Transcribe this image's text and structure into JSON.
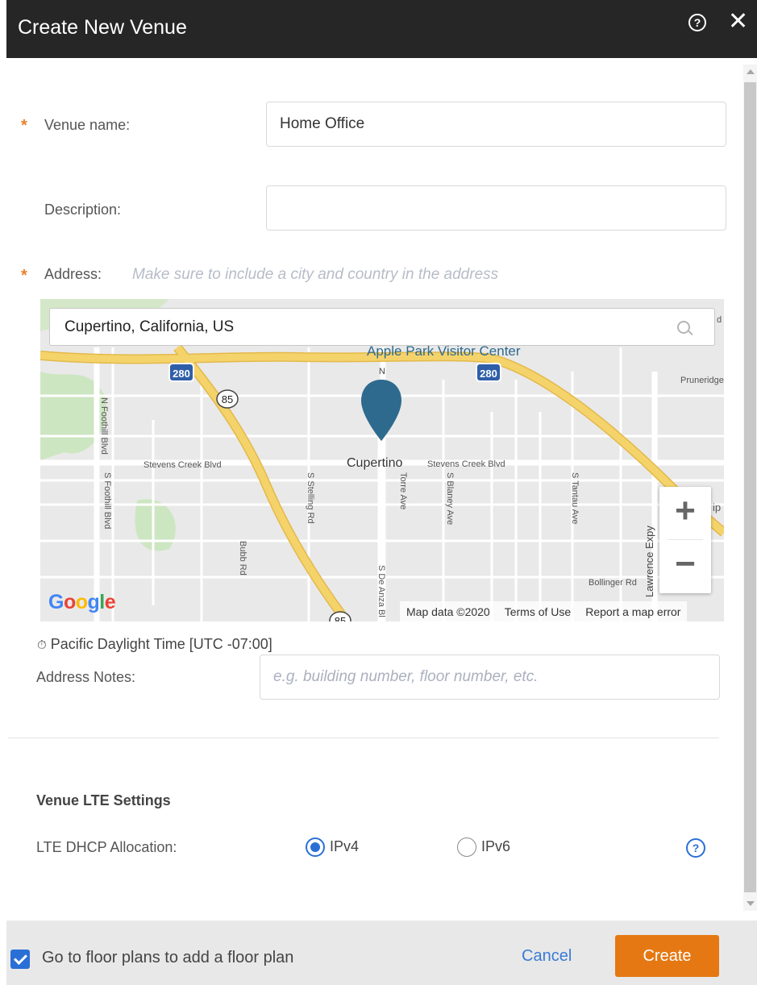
{
  "dialog": {
    "title": "Create New Venue",
    "help_icon": "help-circle-icon",
    "close_icon": "close-icon"
  },
  "form": {
    "required_marker": "*",
    "venue_name": {
      "label": "Venue name:",
      "value": "Home Office"
    },
    "description": {
      "label": "Description:",
      "value": ""
    },
    "address": {
      "label": "Address:",
      "hint": "Make sure to include a city and country in the address"
    },
    "timezone": {
      "icon": "clock-icon",
      "text": "Pacific Daylight Time [UTC -07:00]"
    },
    "address_notes": {
      "label": "Address Notes:",
      "placeholder": "e.g. building number, floor number, etc."
    }
  },
  "map": {
    "search_value": "Cupertino, California, US",
    "labels": {
      "apple_park": "Apple Park Visitor Center",
      "cupertino": "Cupertino",
      "stevens_creek_west": "Stevens Creek Blvd",
      "stevens_creek_east": "Stevens Creek Blvd",
      "n_foothill": "N Foothill Blvd",
      "s_foothill": "S Foothill Blvd",
      "s_stelling": "S Stelling Rd",
      "bubb": "Bubb Rd",
      "torre": "Torre Ave",
      "s_blaney": "S Blaney Ave",
      "s_tantau": "S Tantau Ave",
      "s_de_anza": "S De Anza Bl",
      "bollinger": "Bollinger Rd",
      "lawrence": "Lawrence Expy",
      "pruneridge": "Pruneridge A",
      "n_label": "N",
      "hwy280_left": "280",
      "hwy280_right": "280",
      "hwy85": "85",
      "hwy85_bottom": "85",
      "edge_d": "d",
      "edge_ip": "ip"
    },
    "zoom_in": "+",
    "zoom_out": "−",
    "google_logo": [
      "G",
      "o",
      "o",
      "g",
      "l",
      "e"
    ],
    "attribution": {
      "map_data": "Map data ©2020",
      "terms": "Terms of Use",
      "report": "Report a map error"
    },
    "colors": {
      "highway": "#f5d36b",
      "highway_edge": "#e3b94a",
      "road": "#ffffff",
      "park": "#cde6c2",
      "land": "#e9e9e9",
      "marker": "#2e6a8e"
    }
  },
  "lte": {
    "section_title": "Venue LTE Settings",
    "dhcp_label": "LTE DHCP Allocation:",
    "options": [
      {
        "label": "IPv4",
        "selected": true
      },
      {
        "label": "IPv6",
        "selected": false
      }
    ],
    "help_icon_text": "?"
  },
  "footer": {
    "checkbox_label": "Go to floor plans to add a floor plan",
    "checkbox_checked": true,
    "cancel_label": "Cancel",
    "create_label": "Create"
  },
  "theme": {
    "header_bg": "#262626",
    "accent": "#e57812",
    "link": "#3a7bd5",
    "required": "#e8812a"
  }
}
